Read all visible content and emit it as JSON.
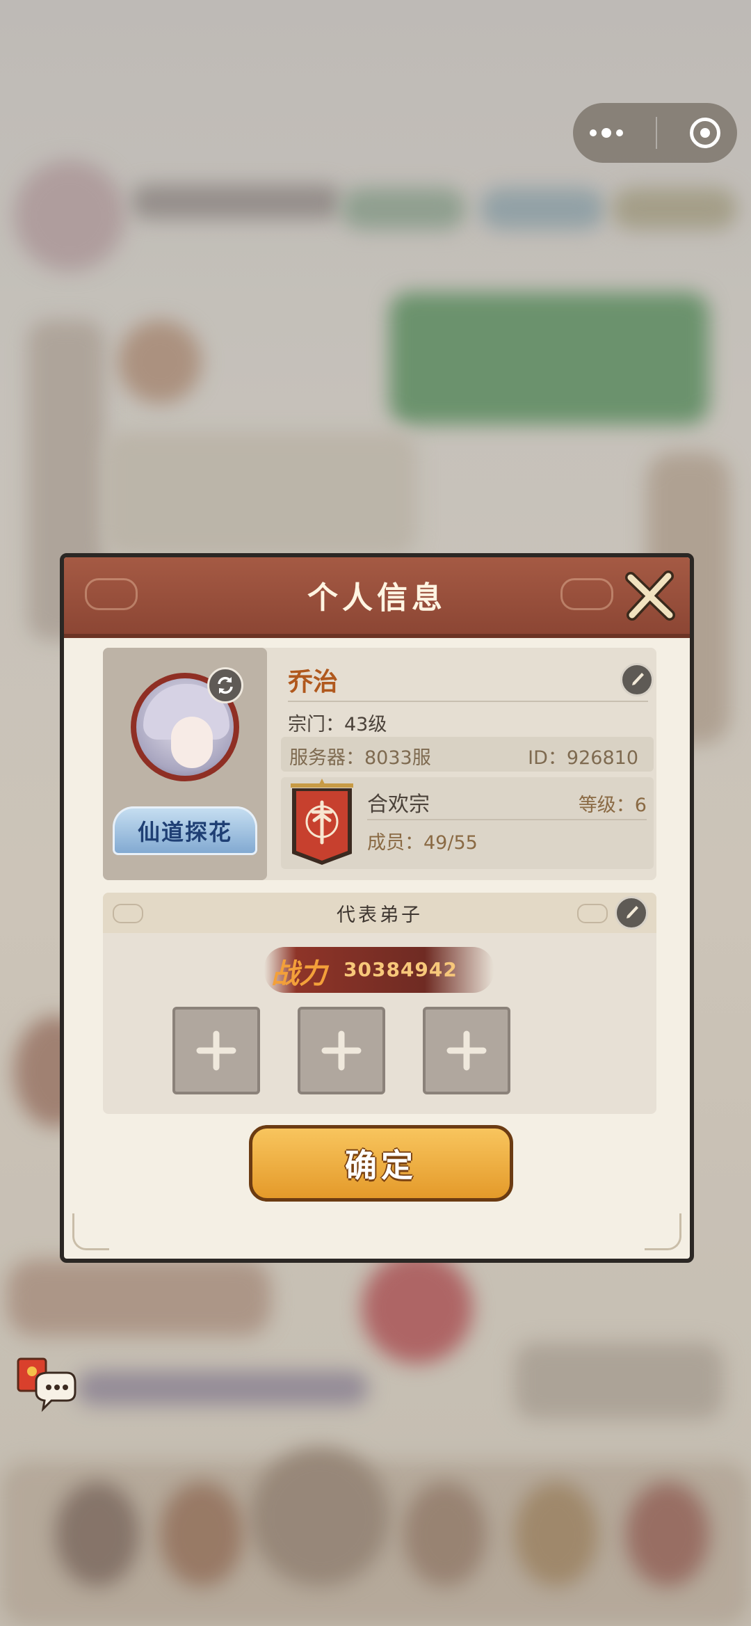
{
  "colors": {
    "header_red": "#9b503c",
    "accent_orange": "#e49a2a",
    "name_orange": "#b0581d",
    "avatar_ring": "#8f2f24"
  },
  "system": {
    "more_icon": "more-dots-icon",
    "close_icon": "target-close-icon"
  },
  "dialog": {
    "title": "个人信息",
    "profile": {
      "name": "乔治",
      "sect_level": "宗门：43级",
      "server": "服务器：8033服",
      "id": "ID：926810",
      "title_badge": "仙道探花"
    },
    "guild": {
      "name": "合欢宗",
      "level": "等级：6",
      "members": "成员：49/55"
    },
    "representatives": {
      "header": "代表弟子",
      "power_label": "战力",
      "power_value": "30384942"
    },
    "confirm_label": "确定"
  }
}
